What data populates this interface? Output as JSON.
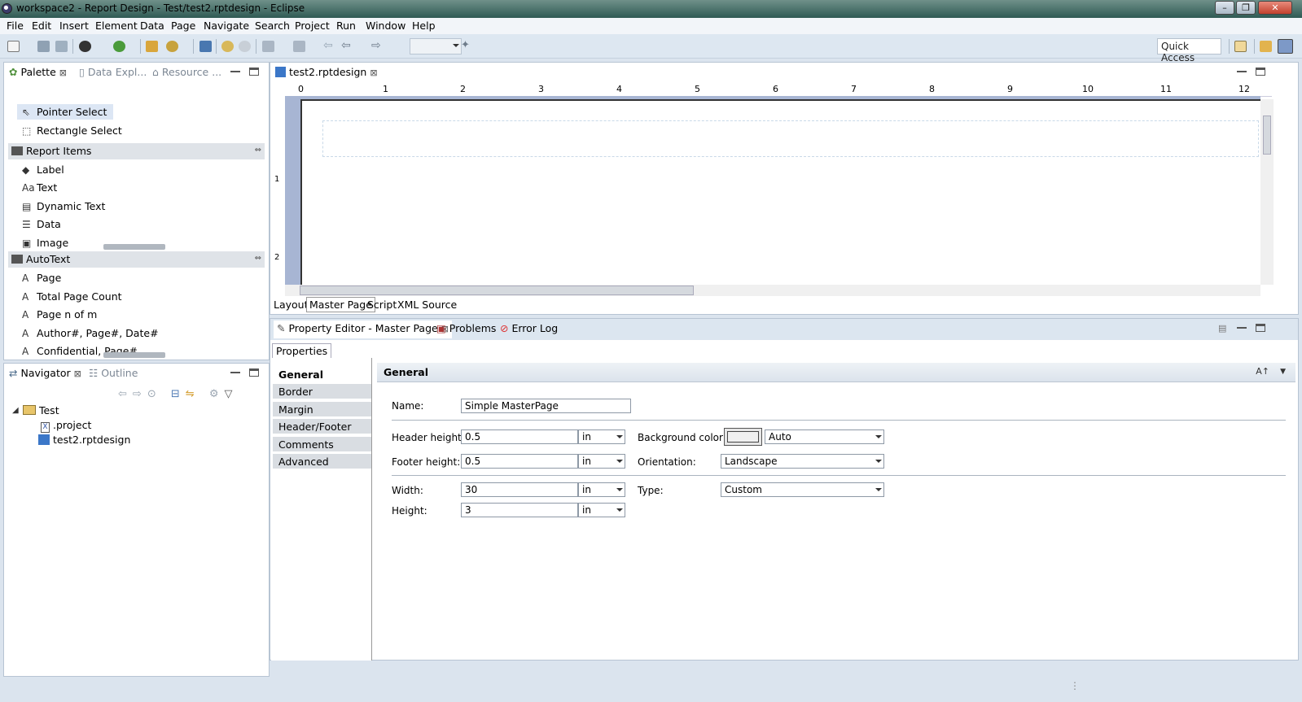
{
  "window": {
    "title": "workspace2 - Report Design - Test/test2.rptdesign - Eclipse"
  },
  "menu": [
    "File",
    "Edit",
    "Insert",
    "Element",
    "Data",
    "Page",
    "Navigate",
    "Search",
    "Project",
    "Run",
    "Window",
    "Help"
  ],
  "toolbar": {
    "quick_access": "Quick Access"
  },
  "palette": {
    "tabs": [
      "Palette",
      "Data Expl...",
      "Resource ..."
    ],
    "tools": [
      "Pointer Select",
      "Rectangle Select"
    ],
    "report_items_header": "Report Items",
    "report_items": [
      "Label",
      "Text",
      "Dynamic Text",
      "Data",
      "Image"
    ],
    "autotext_header": "AutoText",
    "autotext_items": [
      "Page",
      "Total Page Count",
      "Page n of m",
      "Author#, Page#, Date#",
      "Confidential, Page#"
    ]
  },
  "navigator": {
    "tabs": [
      "Navigator",
      "Outline"
    ],
    "tree": {
      "project": "Test",
      "children": [
        ".project",
        "test2.rptdesign"
      ]
    }
  },
  "editor": {
    "tab": "test2.rptdesign",
    "ruler_numbers": [
      "1",
      "2",
      "3",
      "4",
      "5",
      "6",
      "7",
      "8",
      "9",
      "10",
      "11",
      "12"
    ],
    "ruler_zero": "0",
    "ruler_v_numbers": [
      "1",
      "2"
    ],
    "bottom_tabs": [
      "Layout",
      "Master Page",
      "Script",
      "XML Source"
    ],
    "active_bottom_tab": "Master Page"
  },
  "property_panel": {
    "tabs": [
      "Property Editor - Master Page",
      "Problems",
      "Error Log"
    ],
    "sub_tab": "Properties",
    "categories": [
      "General",
      "Border",
      "Margin",
      "Header/Footer",
      "Comments",
      "Advanced"
    ],
    "section_title": "General",
    "fields": {
      "name": {
        "label": "Name:",
        "value": "Simple MasterPage"
      },
      "header_height": {
        "label": "Header height:",
        "value": "0.5",
        "unit": "in"
      },
      "footer_height": {
        "label": "Footer height:",
        "value": "0.5",
        "unit": "in"
      },
      "width": {
        "label": "Width:",
        "value": "30",
        "unit": "in"
      },
      "height": {
        "label": "Height:",
        "value": "3",
        "unit": "in"
      },
      "background_color": {
        "label": "Background color:",
        "value": "Auto"
      },
      "orientation": {
        "label": "Orientation:",
        "value": "Landscape"
      },
      "type": {
        "label": "Type:",
        "value": "Custom"
      }
    }
  }
}
